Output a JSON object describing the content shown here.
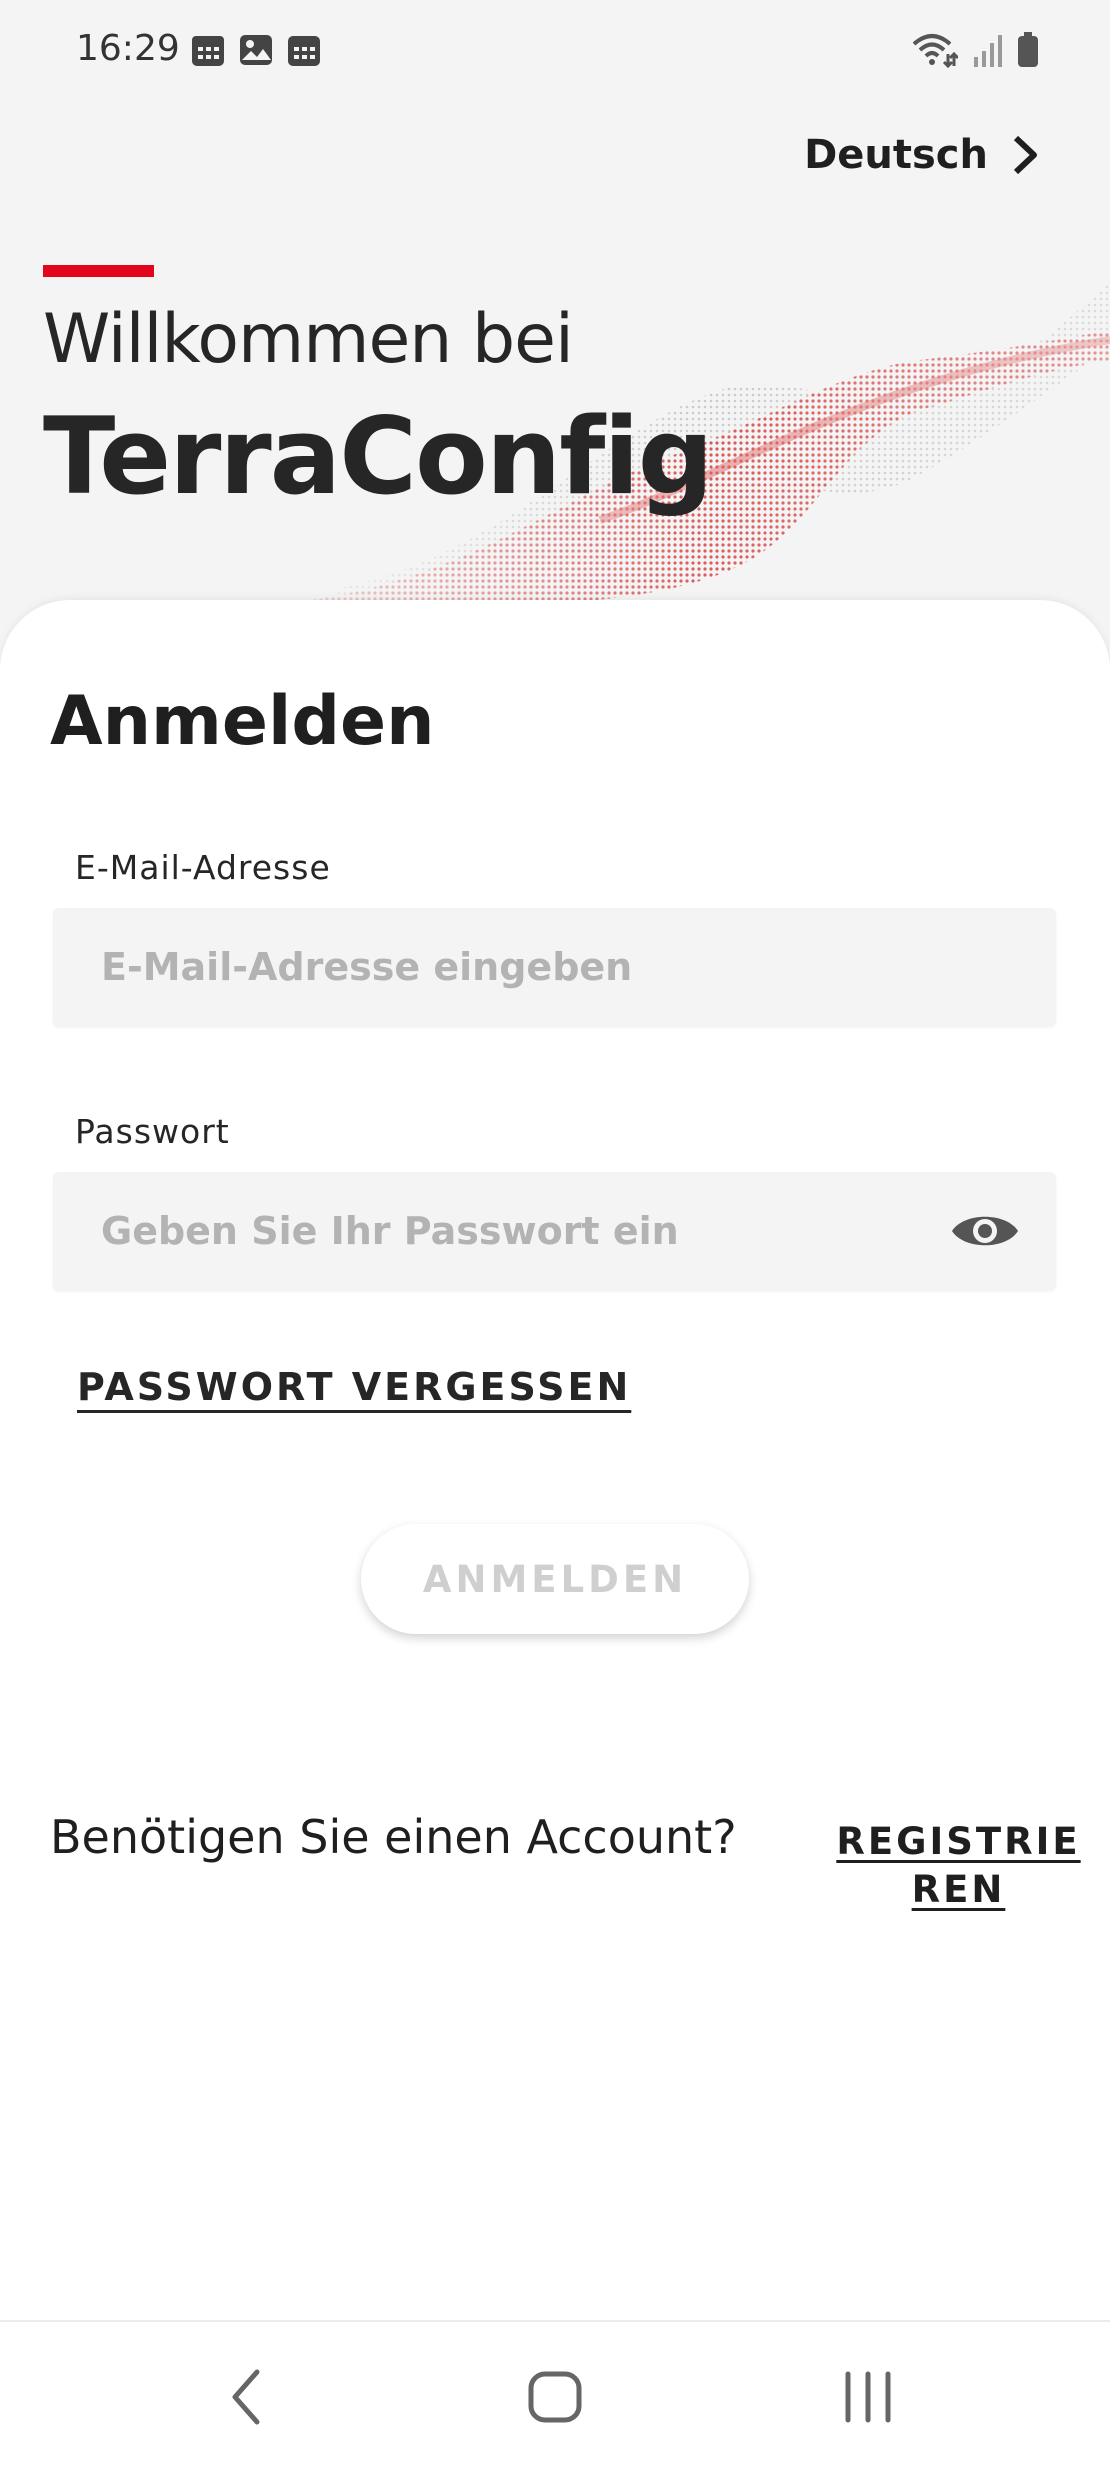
{
  "status_bar": {
    "time": "16:29",
    "notification_icons": [
      "calendar-icon",
      "image-icon",
      "calendar-icon"
    ],
    "right_icons": [
      "wifi-icon",
      "signal-icon",
      "battery-icon"
    ]
  },
  "header": {
    "language_label": "Deutsch",
    "welcome_text": "Willkommen bei",
    "brand_name": "TerraConfig"
  },
  "login": {
    "title": "Anmelden",
    "email": {
      "label": "E-Mail-Adresse",
      "placeholder": "E-Mail-Adresse eingeben",
      "value": ""
    },
    "password": {
      "label": "Passwort",
      "placeholder": "Geben Sie Ihr Passwort ein",
      "value": ""
    },
    "forgot_password": "PASSWORT VERGESSEN",
    "submit_label": "ANMELDEN",
    "need_account": "Benötigen Sie einen Account?",
    "register_label": "REGISTRIEREN"
  },
  "colors": {
    "accent": "#e3051b",
    "text": "#1f1f1f",
    "input_bg": "#f4f4f4",
    "disabled_text": "#cfcfcf"
  },
  "navigation": {
    "buttons": [
      "back-icon",
      "home-icon",
      "recents-icon"
    ]
  }
}
